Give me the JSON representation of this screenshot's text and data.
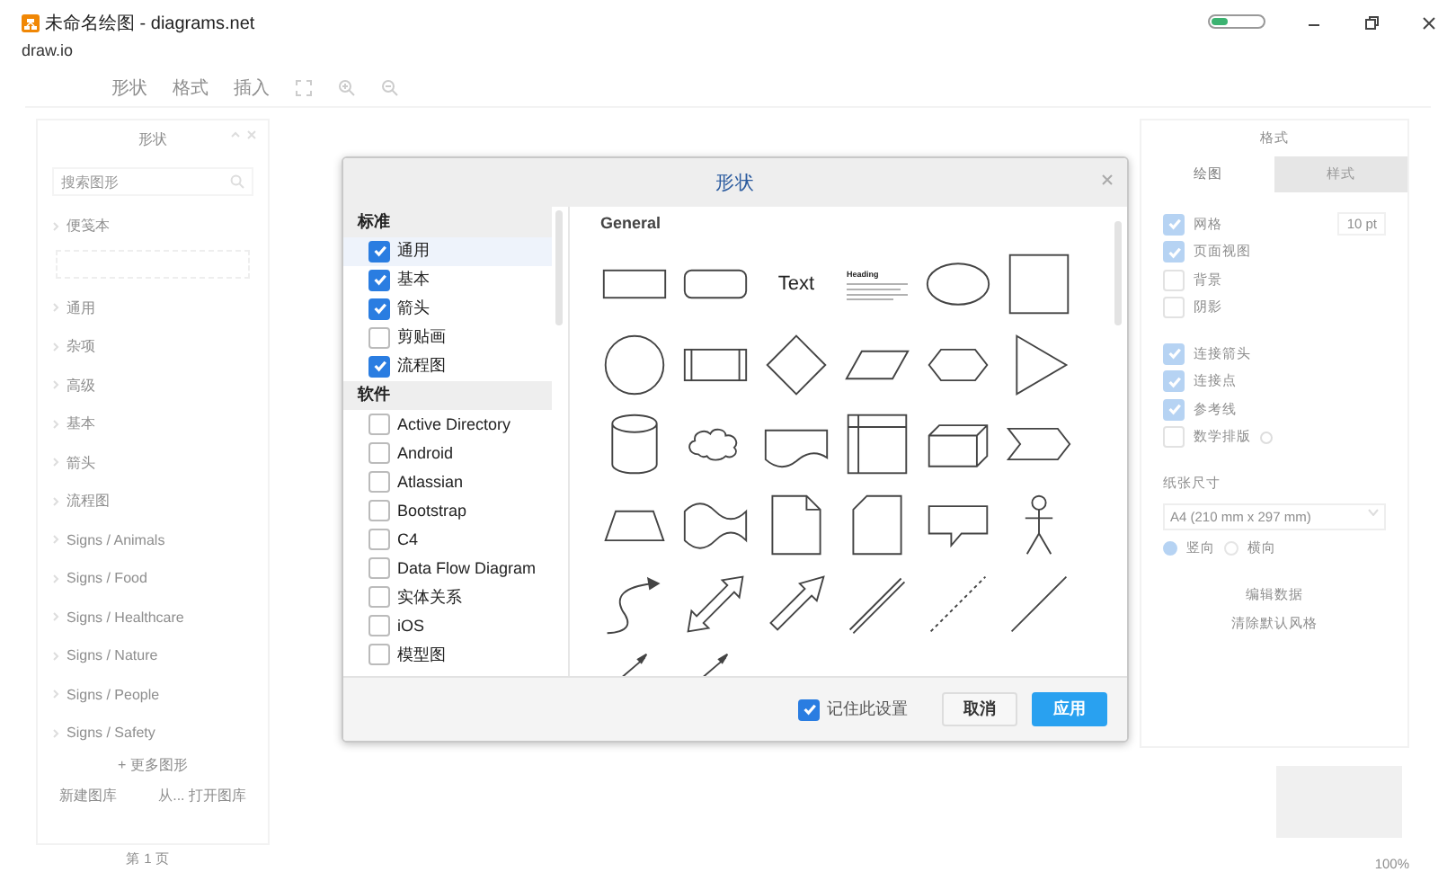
{
  "window": {
    "title": "未命名绘图 - diagrams.net",
    "app_name": "draw.io"
  },
  "toolbar": {
    "items": [
      "形状",
      "格式",
      "插入"
    ]
  },
  "shapes_panel": {
    "title": "形状",
    "search_placeholder": "搜索图形",
    "scratchpad": "便笺本",
    "categories": [
      "通用",
      "杂项",
      "高级",
      "基本",
      "箭头",
      "流程图",
      "Signs / Animals",
      "Signs / Food",
      "Signs / Healthcare",
      "Signs / Nature",
      "Signs / People",
      "Signs / Safety"
    ],
    "more": "+ 更多图形",
    "new_library": "新建图库",
    "open_library": "从... 打开图库"
  },
  "page_tab": "第 1 页",
  "format_panel": {
    "title": "格式",
    "tabs": [
      {
        "label": "绘图",
        "selected": true
      },
      {
        "label": "样式",
        "selected": false
      }
    ],
    "grid_size": "10 pt",
    "options": [
      {
        "label": "网格",
        "checked": true
      },
      {
        "label": "页面视图",
        "checked": true
      },
      {
        "label": "背景",
        "checked": false
      },
      {
        "label": "阴影",
        "checked": false
      },
      {
        "label": "连接箭头",
        "checked": true
      },
      {
        "label": "连接点",
        "checked": true
      },
      {
        "label": "参考线",
        "checked": true
      },
      {
        "label": "数学排版",
        "checked": false
      }
    ],
    "paper_size_label": "纸张尺寸",
    "paper_size": "A4 (210 mm x 297 mm)",
    "orientations": [
      {
        "label": "竖向",
        "selected": true
      },
      {
        "label": "横向",
        "selected": false
      }
    ],
    "buttons": [
      "编辑数据",
      "清除默认风格"
    ]
  },
  "zoom": "100%",
  "dialog": {
    "title": "形状",
    "groups": [
      {
        "title": "标准",
        "items": [
          {
            "label": "通用",
            "checked": true,
            "selected": true
          },
          {
            "label": "基本",
            "checked": true,
            "selected": false
          },
          {
            "label": "箭头",
            "checked": true,
            "selected": false
          },
          {
            "label": "剪贴画",
            "checked": false,
            "selected": false
          },
          {
            "label": "流程图",
            "checked": true,
            "selected": false
          }
        ]
      },
      {
        "title": "软件",
        "items": [
          {
            "label": "Active Directory",
            "checked": false,
            "selected": false
          },
          {
            "label": "Android",
            "checked": false,
            "selected": false
          },
          {
            "label": "Atlassian",
            "checked": false,
            "selected": false
          },
          {
            "label": "Bootstrap",
            "checked": false,
            "selected": false
          },
          {
            "label": "C4",
            "checked": false,
            "selected": false
          },
          {
            "label": "Data Flow Diagram",
            "checked": false,
            "selected": false
          },
          {
            "label": "实体关系",
            "checked": false,
            "selected": false
          },
          {
            "label": "iOS",
            "checked": false,
            "selected": false
          },
          {
            "label": "模型图",
            "checked": false,
            "selected": false
          }
        ]
      }
    ],
    "section_title": "General",
    "shapes": [
      {
        "kind": "rectangle"
      },
      {
        "kind": "rounded"
      },
      {
        "kind": "text",
        "text": "Text"
      },
      {
        "kind": "textbox",
        "text": "Heading"
      },
      {
        "kind": "ellipse"
      },
      {
        "kind": "square"
      },
      {
        "kind": "circle"
      },
      {
        "kind": "process"
      },
      {
        "kind": "diamond"
      },
      {
        "kind": "parallelogram"
      },
      {
        "kind": "hexagon"
      },
      {
        "kind": "triangle"
      },
      {
        "kind": "cylinder"
      },
      {
        "kind": "cloud"
      },
      {
        "kind": "document"
      },
      {
        "kind": "storage"
      },
      {
        "kind": "cube"
      },
      {
        "kind": "step"
      },
      {
        "kind": "trapezoid"
      },
      {
        "kind": "tape"
      },
      {
        "kind": "note"
      },
      {
        "kind": "card"
      },
      {
        "kind": "callout"
      },
      {
        "kind": "actor"
      },
      {
        "kind": "curve"
      },
      {
        "kind": "double-arrow"
      },
      {
        "kind": "arrow"
      },
      {
        "kind": "link"
      },
      {
        "kind": "dashed"
      },
      {
        "kind": "line"
      },
      {
        "kind": "connector"
      },
      {
        "kind": "connector"
      }
    ],
    "remember": {
      "label": "记住此设置",
      "checked": true
    },
    "buttons": [
      {
        "label": "取消",
        "kind": "secondary"
      },
      {
        "label": "应用",
        "kind": "primary"
      }
    ]
  }
}
